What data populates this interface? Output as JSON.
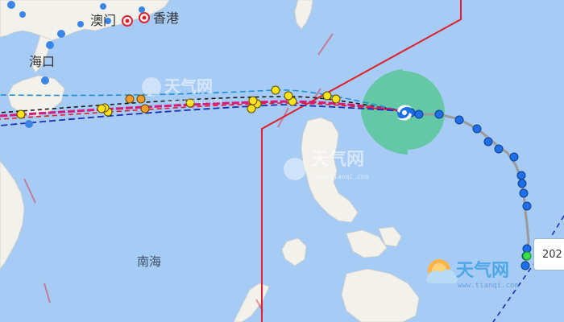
{
  "places": {
    "macau": "澳门",
    "hongkong": "香港",
    "haikou": "海口",
    "south_sea": "南海"
  },
  "watermark": {
    "brand": "天气网",
    "domain": "www.tianqi.com"
  },
  "track_tag": "202",
  "colors": {
    "sea": "#a6cbf5",
    "land": "#f3f1ec",
    "typhoon_zone": "#5dc79c",
    "track_observed": "#9a9a9a",
    "point_blue": "#1e6fe8",
    "point_yellow": "#ffe21a",
    "point_orange": "#f39a2c",
    "point_green": "#36e04a",
    "warning_line_red": "#e0202c",
    "forecast_black": "#1a1a1a",
    "forecast_magenta": "#d8197a",
    "forecast_navy": "#1d2fb8",
    "forecast_cyan": "#1f8fd6"
  },
  "icons": [
    "typhoon-icon",
    "city-marker-icon",
    "tianqi-logo-icon"
  ]
}
